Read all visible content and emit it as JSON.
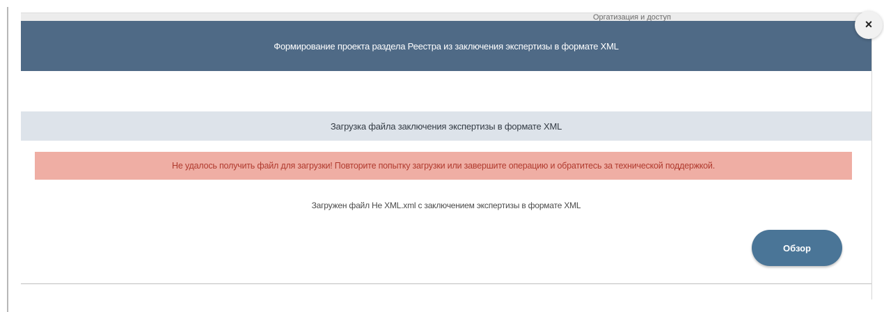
{
  "background_page": {
    "partial_text": "Оргатизация и доступ"
  },
  "modal": {
    "title": "Формирование проекта раздела Реестра из заключения экспертизы в формате XML",
    "close_icon": "×",
    "section_title": "Загрузка файла заключения экспертизы в формате XML",
    "error_message": "Не удалось получить файл для загрузки! Повторите попытку загрузки или завершите операцию и обратитесь за технической поддержкой.",
    "uploaded_file_text": "Загружен файл Не XML.xml с заключением экспертизы в формате XML",
    "browse_label": "Обзор"
  },
  "colors": {
    "header_bg": "#4f6a86",
    "section_bg": "#dde3ea",
    "error_bg": "#efaea4",
    "error_text": "#b03a2e",
    "button_bg": "#4a7597"
  },
  "icons": {
    "close": "close-icon"
  }
}
